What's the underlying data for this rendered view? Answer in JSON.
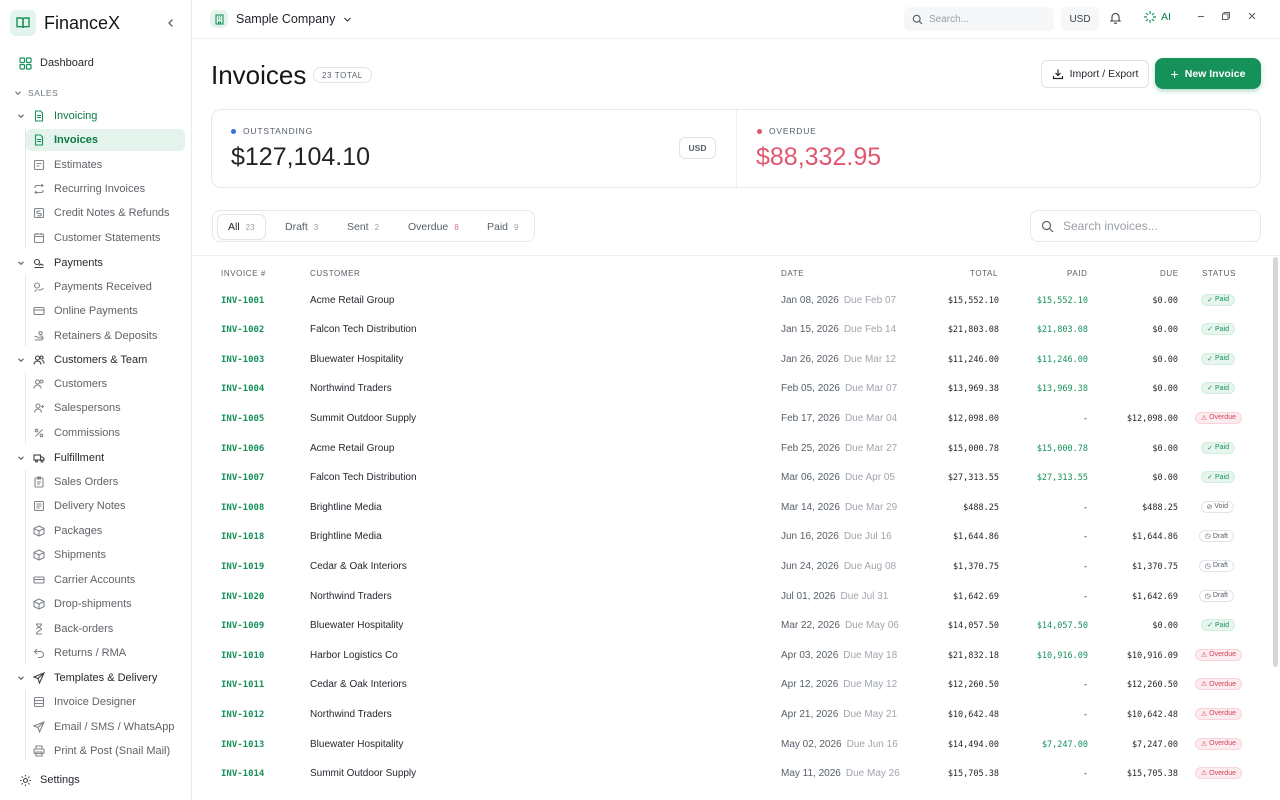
{
  "app": {
    "name": "FinanceX"
  },
  "sidebar": {
    "dashboard": "Dashboard",
    "section": "SALES",
    "groups": [
      {
        "label": "Invoicing",
        "items": [
          "Invoices",
          "Estimates",
          "Recurring Invoices",
          "Credit Notes & Refunds",
          "Customer Statements"
        ]
      },
      {
        "label": "Payments",
        "items": [
          "Payments Received",
          "Online Payments",
          "Retainers & Deposits"
        ]
      },
      {
        "label": "Customers & Team",
        "items": [
          "Customers",
          "Salespersons",
          "Commissions"
        ]
      },
      {
        "label": "Fulfillment",
        "items": [
          "Sales Orders",
          "Delivery Notes",
          "Packages",
          "Shipments",
          "Carrier Accounts",
          "Drop-shipments",
          "Back-orders",
          "Returns / RMA"
        ]
      },
      {
        "label": "Templates & Delivery",
        "items": [
          "Invoice Designer",
          "Email / SMS / WhatsApp",
          "Print & Post (Snail Mail)"
        ]
      }
    ],
    "settings": "Settings"
  },
  "topbar": {
    "company": "Sample Company",
    "search_placeholder": "Search...",
    "currency": "USD",
    "ai": "AI"
  },
  "page": {
    "title": "Invoices",
    "total_badge": "23 TOTAL",
    "import_export": "Import / Export",
    "new_invoice": "New Invoice"
  },
  "summary": {
    "outstanding_label": "OUTSTANDING",
    "outstanding_value": "$127,104.10",
    "currency_badge": "USD",
    "overdue_label": "OVERDUE",
    "overdue_value": "$88,332.95"
  },
  "tabs": [
    {
      "label": "All",
      "count": "23"
    },
    {
      "label": "Draft",
      "count": "3"
    },
    {
      "label": "Sent",
      "count": "2"
    },
    {
      "label": "Overdue",
      "count": "8"
    },
    {
      "label": "Paid",
      "count": "9"
    }
  ],
  "list_search_placeholder": "Search invoices...",
  "table": {
    "headers": {
      "invoice": "INVOICE #",
      "customer": "CUSTOMER",
      "date": "DATE",
      "total": "TOTAL",
      "paid": "PAID",
      "due": "DUE",
      "status": "STATUS"
    },
    "rows": [
      {
        "inv": "INV-1001",
        "customer": "Acme Retail Group",
        "date": "Jan 08, 2026",
        "due_date": "Due Feb 07",
        "total": "$15,552.10",
        "paid": "$15,552.10",
        "due": "$0.00",
        "status": "Paid"
      },
      {
        "inv": "INV-1002",
        "customer": "Falcon Tech Distribution",
        "date": "Jan 15, 2026",
        "due_date": "Due Feb 14",
        "total": "$21,803.08",
        "paid": "$21,803.08",
        "due": "$0.00",
        "status": "Paid"
      },
      {
        "inv": "INV-1003",
        "customer": "Bluewater Hospitality",
        "date": "Jan 26, 2026",
        "due_date": "Due Mar 12",
        "total": "$11,246.00",
        "paid": "$11,246.00",
        "due": "$0.00",
        "status": "Paid"
      },
      {
        "inv": "INV-1004",
        "customer": "Northwind Traders",
        "date": "Feb 05, 2026",
        "due_date": "Due Mar 07",
        "total": "$13,969.38",
        "paid": "$13,969.38",
        "due": "$0.00",
        "status": "Paid"
      },
      {
        "inv": "INV-1005",
        "customer": "Summit Outdoor Supply",
        "date": "Feb 17, 2026",
        "due_date": "Due Mar 04",
        "total": "$12,098.00",
        "paid": "-",
        "due": "$12,098.00",
        "status": "Overdue"
      },
      {
        "inv": "INV-1006",
        "customer": "Acme Retail Group",
        "date": "Feb 25, 2026",
        "due_date": "Due Mar 27",
        "total": "$15,000.78",
        "paid": "$15,000.78",
        "due": "$0.00",
        "status": "Paid"
      },
      {
        "inv": "INV-1007",
        "customer": "Falcon Tech Distribution",
        "date": "Mar 06, 2026",
        "due_date": "Due Apr 05",
        "total": "$27,313.55",
        "paid": "$27,313.55",
        "due": "$0.00",
        "status": "Paid"
      },
      {
        "inv": "INV-1008",
        "customer": "Brightline Media",
        "date": "Mar 14, 2026",
        "due_date": "Due Mar 29",
        "total": "$488.25",
        "paid": "-",
        "due": "$488.25",
        "status": "Void"
      },
      {
        "inv": "INV-1018",
        "customer": "Brightline Media",
        "date": "Jun 16, 2026",
        "due_date": "Due Jul 16",
        "total": "$1,644.86",
        "paid": "-",
        "due": "$1,644.86",
        "status": "Draft"
      },
      {
        "inv": "INV-1019",
        "customer": "Cedar & Oak Interiors",
        "date": "Jun 24, 2026",
        "due_date": "Due Aug 08",
        "total": "$1,370.75",
        "paid": "-",
        "due": "$1,370.75",
        "status": "Draft"
      },
      {
        "inv": "INV-1020",
        "customer": "Northwind Traders",
        "date": "Jul 01, 2026",
        "due_date": "Due Jul 31",
        "total": "$1,642.69",
        "paid": "-",
        "due": "$1,642.69",
        "status": "Draft"
      },
      {
        "inv": "INV-1009",
        "customer": "Bluewater Hospitality",
        "date": "Mar 22, 2026",
        "due_date": "Due May 06",
        "total": "$14,057.50",
        "paid": "$14,057.50",
        "due": "$0.00",
        "status": "Paid"
      },
      {
        "inv": "INV-1010",
        "customer": "Harbor Logistics Co",
        "date": "Apr 03, 2026",
        "due_date": "Due May 18",
        "total": "$21,832.18",
        "paid": "$10,916.09",
        "due": "$10,916.09",
        "status": "Overdue"
      },
      {
        "inv": "INV-1011",
        "customer": "Cedar & Oak Interiors",
        "date": "Apr 12, 2026",
        "due_date": "Due May 12",
        "total": "$12,260.50",
        "paid": "-",
        "due": "$12,260.50",
        "status": "Overdue"
      },
      {
        "inv": "INV-1012",
        "customer": "Northwind Traders",
        "date": "Apr 21, 2026",
        "due_date": "Due May 21",
        "total": "$10,642.48",
        "paid": "-",
        "due": "$10,642.48",
        "status": "Overdue"
      },
      {
        "inv": "INV-1013",
        "customer": "Bluewater Hospitality",
        "date": "May 02, 2026",
        "due_date": "Due Jun 16",
        "total": "$14,494.00",
        "paid": "$7,247.00",
        "due": "$7,247.00",
        "status": "Overdue"
      },
      {
        "inv": "INV-1014",
        "customer": "Summit Outdoor Supply",
        "date": "May 11, 2026",
        "due_date": "Due May 26",
        "total": "$15,705.38",
        "paid": "-",
        "due": "$15,705.38",
        "status": "Overdue"
      }
    ]
  },
  "colors": {
    "accent": "#17915a",
    "overdue": "#d0435b",
    "outstanding_dot": "#3b6fe0"
  }
}
